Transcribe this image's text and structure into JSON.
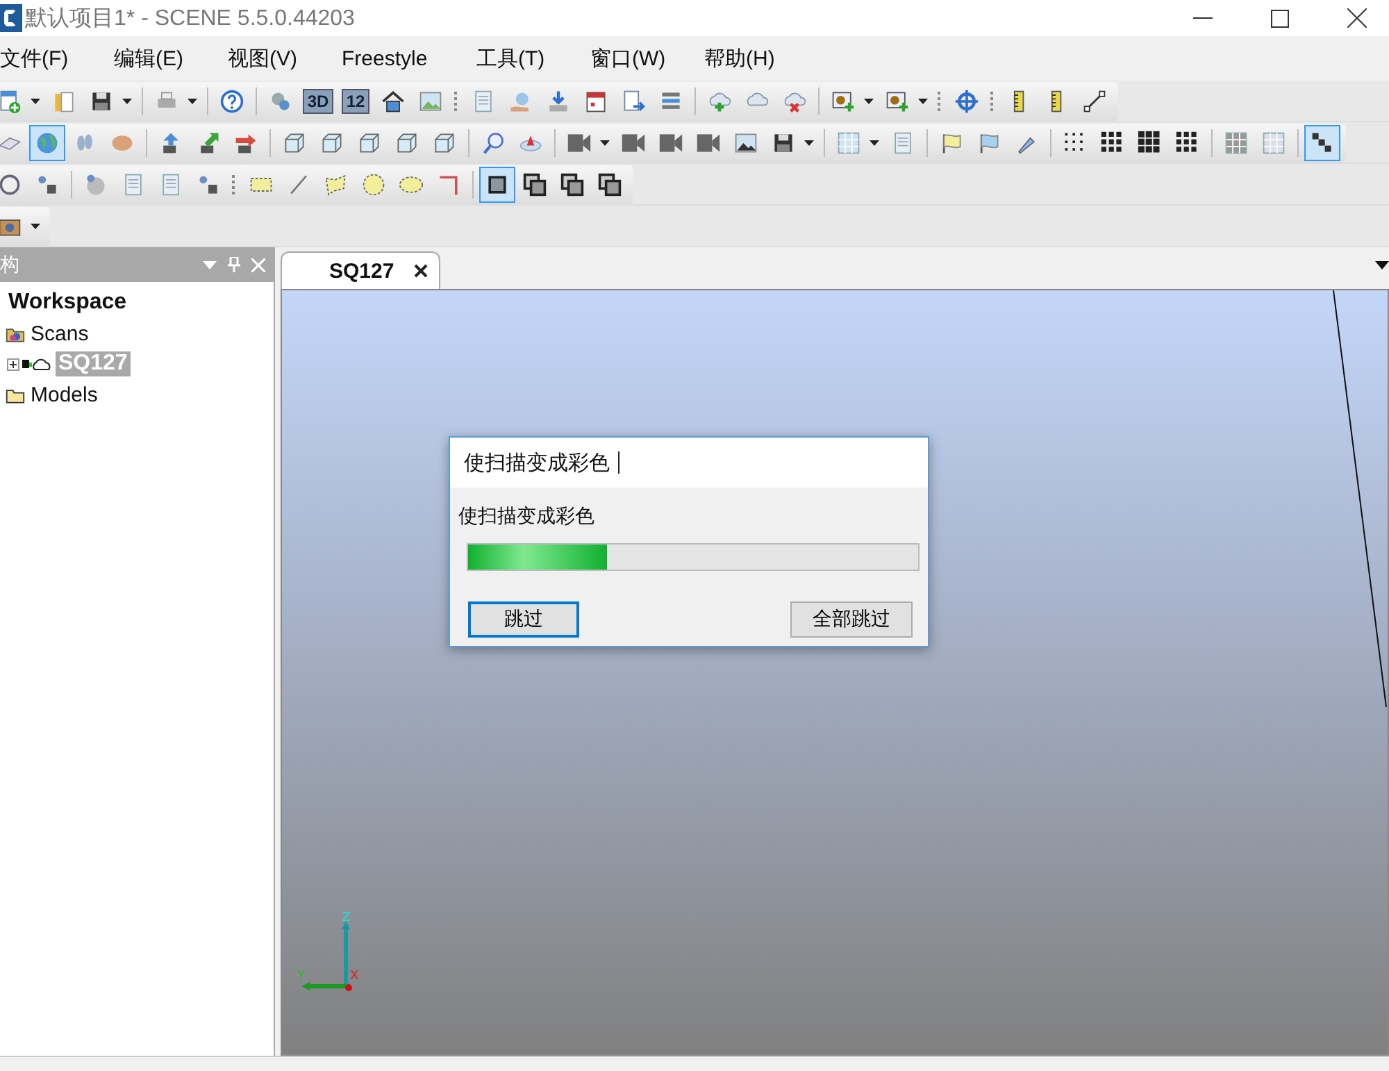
{
  "window": {
    "title": "默认项目1* - SCENE 5.5.0.44203"
  },
  "menu": [
    "文件(F)",
    "编辑(E)",
    "视图(V)",
    "Freestyle",
    "工具(T)",
    "窗口(W)",
    "帮助(H)"
  ],
  "toolbars": [
    {
      "buttons": [
        {
          "selected": false
        },
        {
          "selected": false
        },
        {
          "selected": false
        },
        {
          "selected": false
        },
        {
          "selected": false
        },
        {
          "selected": false
        },
        {
          "text": "3D",
          "selected": false
        },
        {
          "text": "12",
          "selected": false
        },
        {
          "selected": false
        },
        {
          "selected": false
        },
        {
          "selected": false
        },
        {
          "selected": false
        },
        {
          "selected": false
        },
        {
          "selected": false
        },
        {
          "selected": false
        },
        {
          "selected": false
        },
        {
          "selected": false
        },
        {
          "selected": false
        },
        {
          "selected": false
        },
        {
          "selected": false
        },
        {
          "selected": false
        },
        {
          "selected": false
        },
        {
          "selected": false
        },
        {
          "selected": false
        },
        {
          "selected": false
        }
      ]
    },
    {
      "buttons": [
        {
          "selected": false
        },
        {
          "selected": true
        },
        {
          "selected": false
        },
        {
          "selected": false
        },
        {
          "selected": false
        },
        {
          "selected": false
        },
        {
          "selected": false
        },
        {
          "selected": false
        },
        {
          "selected": false
        },
        {
          "selected": false
        },
        {
          "selected": false
        },
        {
          "selected": false
        },
        {
          "selected": false
        },
        {
          "selected": false
        },
        {
          "selected": false
        },
        {
          "selected": false
        },
        {
          "selected": false
        },
        {
          "selected": false
        },
        {
          "selected": false
        },
        {
          "selected": false
        },
        {
          "selected": false
        },
        {
          "selected": false
        },
        {
          "selected": false
        },
        {
          "selected": false
        },
        {
          "selected": false
        },
        {
          "selected": false
        },
        {
          "selected": false
        },
        {
          "selected": false
        },
        {
          "selected": false
        },
        {
          "selected": false
        },
        {
          "selected": false
        },
        {
          "selected": true
        }
      ]
    },
    {
      "buttons": [
        {
          "selected": false
        },
        {
          "selected": false
        },
        {
          "selected": false
        },
        {
          "selected": false
        },
        {
          "selected": false
        },
        {
          "selected": false
        },
        {
          "selected": false
        },
        {
          "selected": false
        },
        {
          "selected": false
        },
        {
          "selected": false
        },
        {
          "selected": false
        },
        {
          "selected": false
        },
        {
          "selected": true
        },
        {
          "selected": false
        },
        {
          "selected": false
        },
        {
          "selected": false
        }
      ]
    },
    {
      "buttons": [
        {
          "selected": false
        }
      ]
    }
  ],
  "structure_panel": {
    "title": "构",
    "tree": [
      {
        "label": "Workspace",
        "kind": "root",
        "children": [
          {
            "label": "Scans",
            "kind": "scans",
            "expanded": true,
            "children": [
              {
                "label": "SQ127",
                "kind": "scan",
                "selected": true,
                "expanded": false
              }
            ]
          },
          {
            "label": "Models",
            "kind": "models",
            "expanded": false
          }
        ]
      }
    ]
  },
  "tabs": [
    {
      "label": "SQ127",
      "selected": true
    }
  ],
  "dialog": {
    "title": "使扫描变成彩色",
    "message": "使扫描变成彩色",
    "level": 0.31,
    "buttons": [
      {
        "label": "跳过",
        "focused": true
      },
      {
        "label": "全部跳过",
        "focused": false
      }
    ]
  },
  "axes": {
    "x": "X",
    "y": "Y",
    "z": "Z"
  }
}
